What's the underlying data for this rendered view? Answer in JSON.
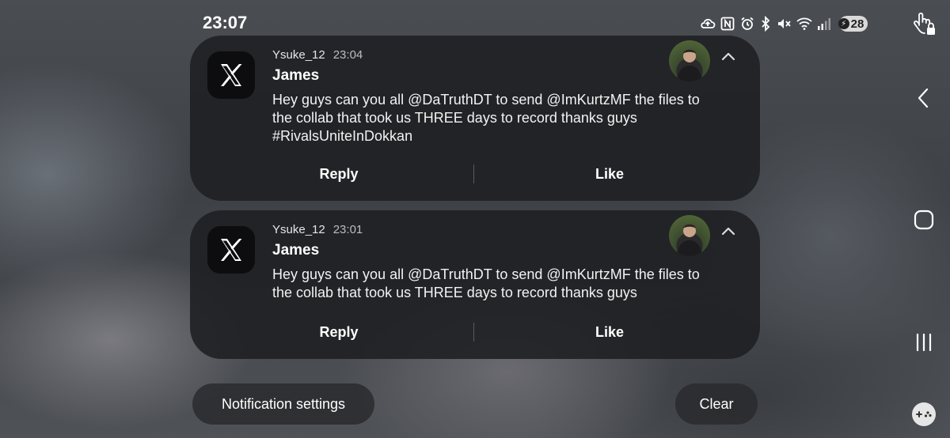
{
  "status": {
    "time": "23:07",
    "battery": "28",
    "icons": [
      "cloud-upload-icon",
      "nfc-icon",
      "alarm-icon",
      "bluetooth-icon",
      "mute-icon",
      "wifi-icon",
      "signal-icon",
      "battery-icon"
    ]
  },
  "notifications": [
    {
      "app_icon": "x-logo-icon",
      "sender": "Ysuke_12",
      "time": "23:04",
      "title": "James",
      "body_lines": [
        "Hey guys can you all @DaTruthDT to send @ImKurtzMF the files to",
        "the collab that took us THREE days to record thanks guys",
        "#RivalsUniteInDokkan"
      ],
      "reply_label": "Reply",
      "like_label": "Like"
    },
    {
      "app_icon": "x-logo-icon",
      "sender": "Ysuke_12",
      "time": "23:01",
      "title": "James",
      "body_lines": [
        "Hey guys can you all @DaTruthDT to send @ImKurtzMF the files to",
        "the collab that took us THREE days to record thanks guys"
      ],
      "reply_label": "Reply",
      "like_label": "Like"
    }
  ],
  "footer": {
    "settings_label": "Notification settings",
    "clear_label": "Clear"
  },
  "navbar": {
    "icons": [
      "touch-lock-icon",
      "back-icon",
      "home-icon",
      "recents-icon",
      "game-controller-icon"
    ]
  }
}
